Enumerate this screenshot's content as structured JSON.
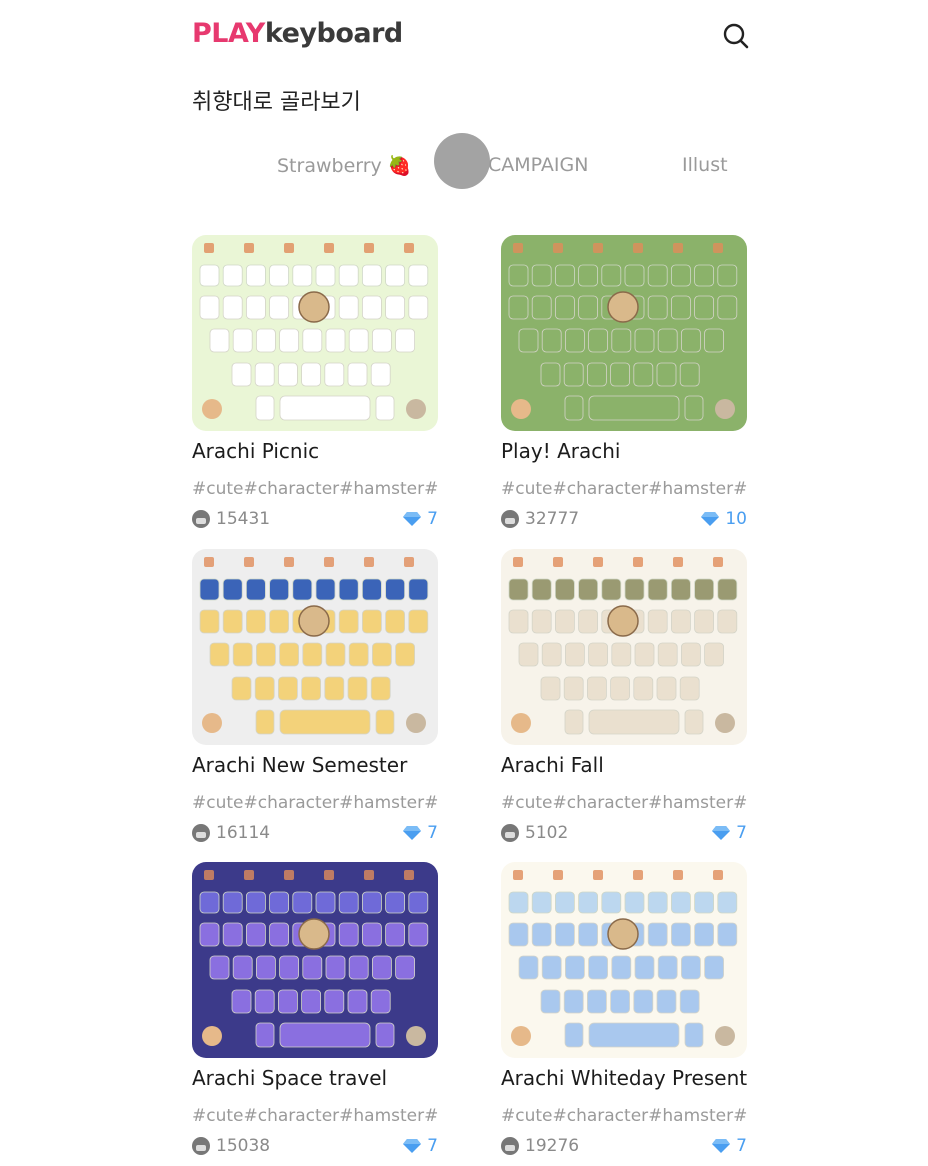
{
  "header": {
    "logo_play": "PLAY",
    "logo_keyboard": "keyboard",
    "search_icon": "search-icon"
  },
  "section_title": "취향대로 골라보기",
  "tabs": [
    {
      "label": "Strawberry 🍓"
    },
    {
      "label": "CAMPAIGN"
    },
    {
      "label": "Illust"
    }
  ],
  "themes": [
    {
      "name": "Arachi Picnic",
      "tags": "#cute#character#hamster#…",
      "downloads": "15431",
      "price": "7",
      "bg": "#eaf6d6",
      "key": "#ffffff",
      "num": "#ffffff"
    },
    {
      "name": "Play! Arachi",
      "tags": "#cute#character#hamster#…",
      "downloads": "32777",
      "price": "10",
      "bg": "#8bb26a",
      "key": "#8bb26a",
      "num": "#8bb26a"
    },
    {
      "name": "Arachi New Semester",
      "tags": "#cute#character#hamster#…",
      "downloads": "16114",
      "price": "7",
      "bg": "#eeeeee",
      "key": "#f3d27a",
      "num": "#3b64b8"
    },
    {
      "name": "Arachi Fall",
      "tags": "#cute#character#hamster#…",
      "downloads": "5102",
      "price": "7",
      "bg": "#f7f3ea",
      "key": "#eae0cf",
      "num": "#9a9a72"
    },
    {
      "name": "Arachi Space travel",
      "tags": "#cute#character#hamster#…",
      "downloads": "15038",
      "price": "7",
      "bg": "#3c3a8a",
      "key": "#8a6fe0",
      "num": "#6f6ad8"
    },
    {
      "name": "Arachi Whiteday Present",
      "tags": "#cute#character#hamster#…",
      "downloads": "19276",
      "price": "7",
      "bg": "#fbf8ee",
      "key": "#a9c8ee",
      "num": "#bcd7ef"
    }
  ]
}
